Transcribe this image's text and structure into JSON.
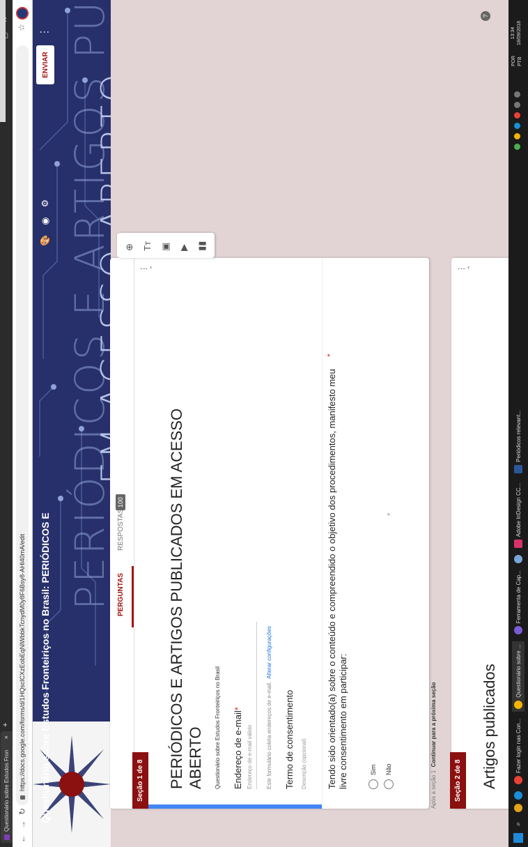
{
  "browser": {
    "tab_title": "Questionário sobre Estudos Fron",
    "tab_close": "×",
    "new_tab": "+",
    "url": "https://docs.google.com/forms/d/1HQsclCXzEobEqNlWbbkTcnydM0y8F6Bsy8-AHl40mA/edit"
  },
  "header": {
    "title": "Questionário sobre Estudos Fronteiriços no Brasil: PERIÓDICOS E",
    "send_label": "ENVIAR",
    "banner_line1": "PERIÓDICOS E ARTIGOS PUBLICADOS",
    "banner_line2": "EM ACESSO ABERTO"
  },
  "tabs": {
    "questions": "PERGUNTAS",
    "responses": "RESPOSTAS",
    "responses_count": "100"
  },
  "section1": {
    "ribbon": "Seção 1 de 8",
    "title": "PERIÓDICOS E ARTIGOS PUBLICADOS EM ACESSO ABERTO",
    "description": "Questionário sobre Estudos Fronteiriços no Brasil",
    "email_label": "Endereço de e-mail",
    "required_mark": "*",
    "email_placeholder": "Endereço de e-mail válido",
    "email_note": "Este formulário coleta endereços de e-mail.",
    "email_change": "Alterar configurações",
    "consent_title": "Termo de consentimento",
    "consent_desc": "Descrição (opcional)"
  },
  "question1": {
    "text": "Tendo sido orientado(a) sobre o conteúdo e compreendido o objetivo dos procedimentos, manifesto meu livre consentimento em participar:",
    "options": [
      "Sim",
      "Não"
    ]
  },
  "after_section1": {
    "prefix": "Após a seção 1",
    "action": "Continuar para a próxima seção"
  },
  "section2": {
    "ribbon": "Seção 2 de 8",
    "title": "Artigos publicados"
  },
  "taskbar": {
    "apps": [
      "Fazer login nas Con...",
      "Questionário sobre ...",
      "Ferramenta de Cap...",
      "Adobe InDesign CC...",
      "Periódicos relevant..."
    ],
    "lang": "POR",
    "lang2": "PTB",
    "time": "13:34",
    "date": "18/09/2018"
  }
}
